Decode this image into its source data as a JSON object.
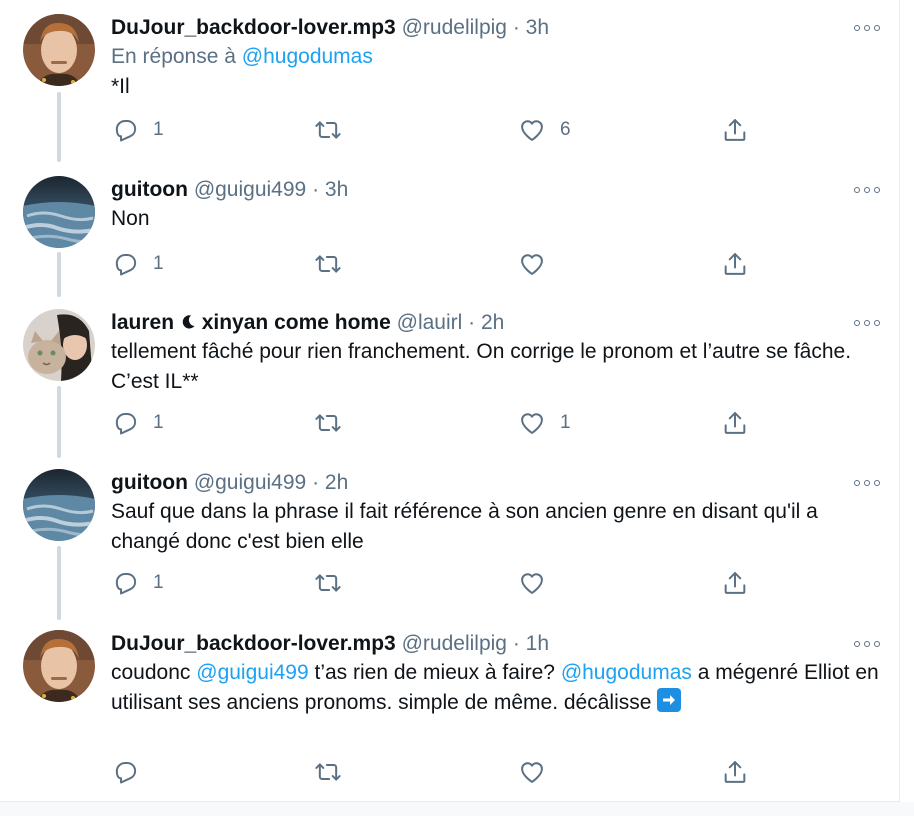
{
  "tweets": [
    {
      "name": "DuJour_backdoor-lover.mp3",
      "handle": "@rudelilpig",
      "dot": "·",
      "time": "3h",
      "reply_prefix": "En réponse à",
      "reply_mention": "@hugodumas",
      "text": "*Il",
      "replies": "1",
      "retweets": "",
      "likes": "6"
    },
    {
      "name": "guitoon",
      "handle": "@guigui499",
      "dot": "·",
      "time": "3h",
      "text": "Non",
      "replies": "1",
      "retweets": "",
      "likes": ""
    },
    {
      "name_part1": "lauren",
      "name_part2": "xinyan come home",
      "handle": "@lauirl",
      "dot": "·",
      "time": "2h",
      "text": "tellement fâché pour rien franchement. On corrige le pronom et l’autre se fâche. C’est IL**",
      "replies": "1",
      "retweets": "",
      "likes": "1"
    },
    {
      "name": "guitoon",
      "handle": "@guigui499",
      "dot": "·",
      "time": "2h",
      "text": "Sauf que dans la phrase il fait référence à son ancien genre en disant qu'il a changé donc c'est bien elle",
      "replies": "1",
      "retweets": "",
      "likes": ""
    },
    {
      "name": "DuJour_backdoor-lover.mp3",
      "handle": "@rudelilpig",
      "dot": "·",
      "time": "1h",
      "text_a": "coudonc",
      "mention_a": "@guigui499",
      "text_b": "t’as rien de mieux à faire?",
      "mention_b": "@hugodumas",
      "text_c": "a mégenré Elliot en utilisant ses anciens pronoms. simple de même. décâlisse",
      "emoji": "right-arrow-emoji",
      "replies": "",
      "retweets": "",
      "likes": ""
    }
  ],
  "icons": {
    "reply": "reply-icon",
    "retweet": "retweet-icon",
    "like": "like-icon",
    "share": "share-icon",
    "more": "more-icon",
    "moon": "moon-icon"
  },
  "colors": {
    "text": "#0f1419",
    "secondary": "#5b7083",
    "link": "#1da1f2",
    "thread_line": "#cfd9de"
  }
}
